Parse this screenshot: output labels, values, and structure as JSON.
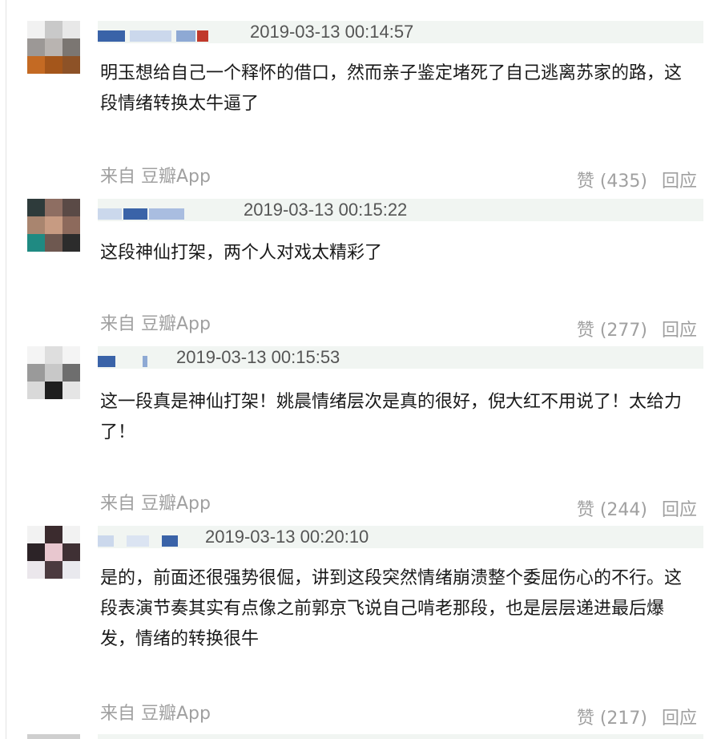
{
  "comments": [
    {
      "timestamp": "2019-03-13 00:14:57",
      "text": "明玉想给自己一个释怀的借口，然而亲子鉴定堵死了自己逃离苏家的路，这段情绪转换太牛逼了",
      "source": "来自 豆瓣App",
      "like": "赞 (435)",
      "reply": "回应"
    },
    {
      "timestamp": "2019-03-13 00:15:22",
      "text": "这段神仙打架，两个人对戏太精彩了",
      "source": "来自 豆瓣App",
      "like": "赞 (277)",
      "reply": "回应"
    },
    {
      "timestamp": "2019-03-13 00:15:53",
      "text": "这一段真是神仙打架！姚晨情绪层次是真的很好，倪大红不用说了！太给力了！",
      "source": "来自 豆瓣App",
      "like": "赞 (244)",
      "reply": "回应"
    },
    {
      "timestamp": "2019-03-13 00:20:10",
      "text": "是的，前面还很强势很倔，讲到这段突然情绪崩溃整个委屈伤心的不行。这段表演节奏其实有点像之前郭京飞说自己啃老那段，也是层层递进最后爆发，情绪的转换很牛",
      "source": "来自 豆瓣App",
      "like": "赞 (217)",
      "reply": "回应"
    }
  ],
  "colors": {
    "meta_bar": "#f1f5f2",
    "muted": "#a0a0a0",
    "name_blue": "#3a63a8"
  },
  "icons": [
    "avatar-icon"
  ]
}
